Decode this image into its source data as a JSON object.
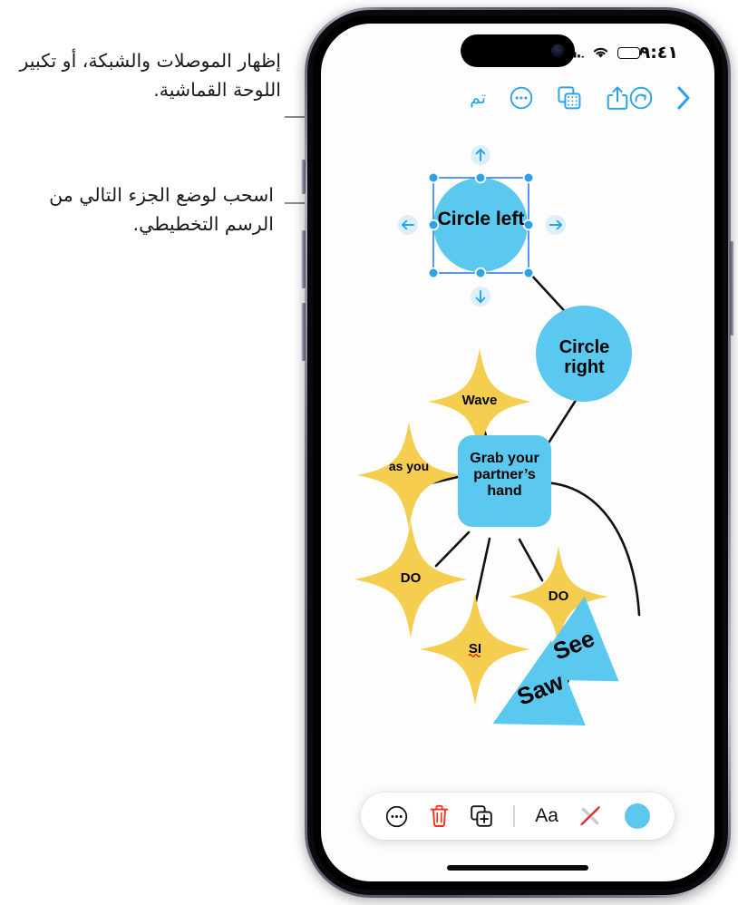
{
  "annotations": {
    "callout_1": "إظهار الموصلات والشبكة، أو تكبير اللوحة القماشية.",
    "callout_2": "اسحب لوضع الجزء التالي من الرسم التخطيطي."
  },
  "statusbar": {
    "time": "٩:٤١",
    "battery_icon": "battery-icon",
    "wifi_icon": "wifi-icon",
    "cellular_icon": "cellular-signal-icon"
  },
  "toolbar": {
    "done_label": "تم",
    "more_icon": "ellipsis-circle-icon",
    "grid_icon": "canvas-grid-icon",
    "share_icon": "share-icon",
    "redo_icon": "redo-icon",
    "forward_icon": "chevron-right-icon"
  },
  "bottom_toolbar": {
    "more_icon": "ellipsis-circle-icon",
    "delete_icon": "trash-icon",
    "duplicate_icon": "duplicate-icon",
    "text_style_label": "Aa",
    "no_outline_icon": "pen-strikethrough-icon",
    "color_swatch": "color-swatch",
    "color_value": "#5BC8F0",
    "delete_color": "#FF2D1F"
  },
  "canvas": {
    "colors": {
      "shape_blue": "#5BC8F0",
      "shape_yellow": "#F5CE50",
      "connector": "#111111",
      "selection": "#2F7FF0",
      "handle": "#2AA3E8"
    },
    "selected_shape": "Circle left",
    "nudge_buttons": [
      {
        "name": "nudge-up",
        "glyph": "↑"
      },
      {
        "name": "nudge-right",
        "glyph": "→"
      },
      {
        "name": "nudge-down",
        "glyph": "↓"
      },
      {
        "name": "nudge-left",
        "glyph": "←"
      }
    ],
    "shapes": [
      {
        "id": "circle-left",
        "type": "circle",
        "label": "Circle left",
        "color": "#5BC8F0",
        "font_size": 21,
        "selected": true
      },
      {
        "id": "circle-right",
        "type": "circle",
        "label": "Circle right",
        "color": "#5BC8F0",
        "font_size": 20,
        "selected": false
      },
      {
        "id": "star-wave",
        "type": "four-point-star",
        "label": "Wave",
        "color": "#F5CE50",
        "font_size": 15,
        "selected": false
      },
      {
        "id": "star-as-you",
        "type": "four-point-star",
        "label": "as you",
        "color": "#F5CE50",
        "font_size": 14,
        "selected": false
      },
      {
        "id": "rect-grab",
        "type": "rounded-rect",
        "label": "Grab your partner’s hand",
        "color": "#5BC8F0",
        "font_size": 16,
        "selected": false
      },
      {
        "id": "star-do-left",
        "type": "four-point-star",
        "label": "DO",
        "color": "#F5CE50",
        "font_size": 15,
        "selected": false
      },
      {
        "id": "star-do-right",
        "type": "four-point-star",
        "label": "DO",
        "color": "#F5CE50",
        "font_size": 15,
        "selected": false
      },
      {
        "id": "star-si",
        "type": "four-point-star",
        "label": "SI",
        "color": "#F5CE50",
        "font_size": 15,
        "selected": false,
        "misspelled": true
      },
      {
        "id": "triangle-see",
        "type": "triangle",
        "label": "See",
        "color": "#5BC8F0",
        "font_size": 26,
        "selected": false
      },
      {
        "id": "triangle-saw",
        "type": "triangle",
        "label": "Saw",
        "color": "#5BC8F0",
        "font_size": 26,
        "selected": false
      }
    ]
  }
}
